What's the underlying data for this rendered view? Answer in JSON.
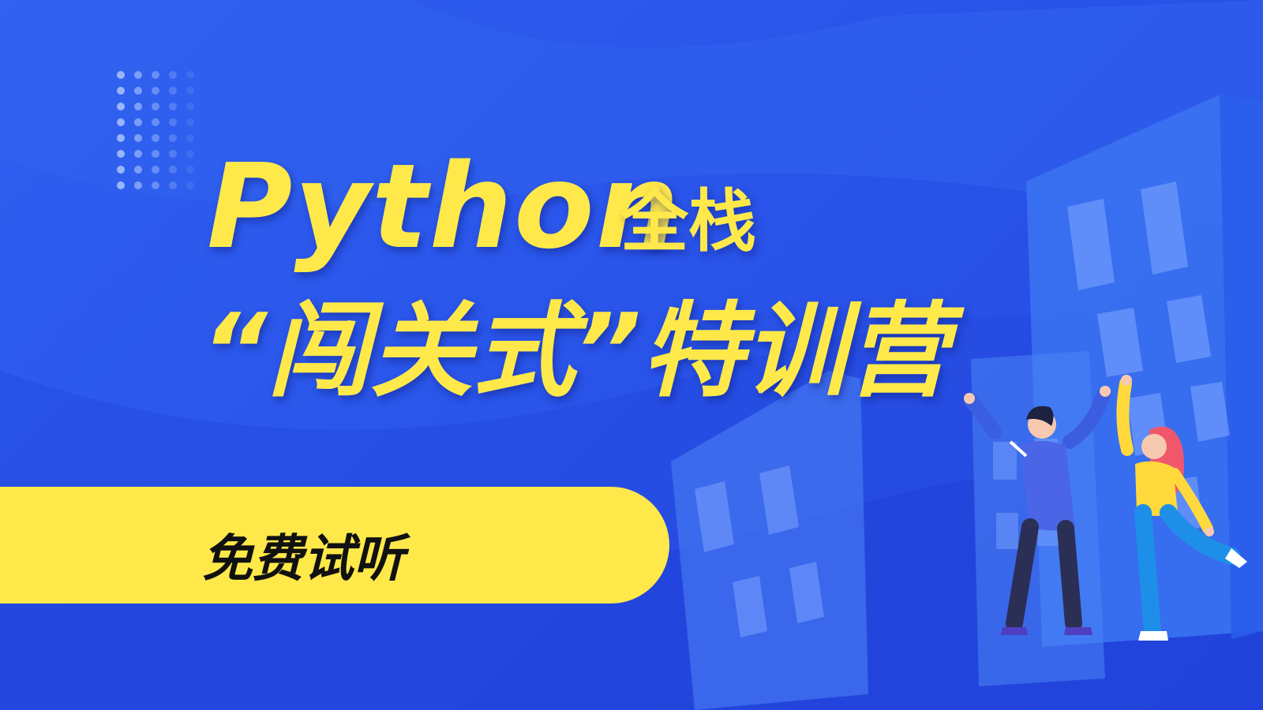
{
  "banner": {
    "title_main": "Python",
    "title_suffix": "全栈",
    "subtitle": "“闯关式”特训营",
    "cta_label": "免费试听"
  },
  "colors": {
    "background": "#2a55ea",
    "accent_yellow": "#ffe94a",
    "cta_text": "#111111"
  },
  "icons": [
    "dot-grid-decoration",
    "building-illustration",
    "man-reaching-illustration",
    "woman-reaching-illustration"
  ]
}
